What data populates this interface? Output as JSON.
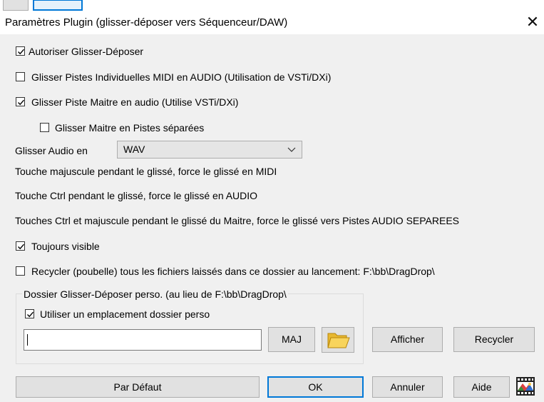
{
  "dialog": {
    "title": "Paramètres Plugin (glisser-déposer vers Séquenceur/DAW)",
    "close_glyph": "✕"
  },
  "options": {
    "allow_drag_drop": {
      "label": "Autoriser Glisser-Déposer",
      "checked": true
    },
    "individual_tracks": {
      "label": "Glisser Pistes Individuelles MIDI en AUDIO (Utilisation de VSTi/DXi)",
      "checked": false
    },
    "master_audio": {
      "label": "Glisser Piste Maitre en audio (Utilise VSTi/DXi)",
      "checked": true
    },
    "master_separate": {
      "label": "Glisser Maitre en Pistes séparées",
      "checked": false
    }
  },
  "audio_format": {
    "label": "Glisser Audio en",
    "value": "WAV"
  },
  "hints": {
    "shift": "Touche majuscule pendant le glissé, force le glissé en MIDI",
    "ctrl": "Touche Ctrl pendant le glissé, force le glissé en AUDIO",
    "ctrl_shift": "Touches Ctrl et majuscule pendant le glissé du Maitre, force le glissé vers Pistes AUDIO SEPAREES"
  },
  "always_visible": {
    "label": "Toujours visible",
    "checked": true
  },
  "recycle_on_launch": {
    "label": "Recycler (poubelle) tous les fichiers laissés dans ce dossier au lancement: F:\\bb\\DragDrop\\",
    "checked": false
  },
  "custom_folder": {
    "group_label": "Dossier Glisser-Déposer perso. (au lieu de F:\\bb\\DragDrop\\",
    "use_custom": {
      "label": "Utiliser un emplacement dossier perso",
      "checked": true
    },
    "path_value": "",
    "maj_button": "MAJ"
  },
  "buttons": {
    "show": "Afficher",
    "recycle": "Recycler",
    "default": "Par Défaut",
    "ok": "OK",
    "cancel": "Annuler",
    "help": "Aide"
  },
  "icons": {
    "folder": "folder-icon",
    "film": "film-icon",
    "close": "close-icon",
    "chevron": "chevron-down-icon"
  },
  "colors": {
    "dialog_bg": "#f0f0f0",
    "accent": "#0078d7",
    "button_bg": "#e1e1e1",
    "folder_yellow": "#f5c542"
  }
}
